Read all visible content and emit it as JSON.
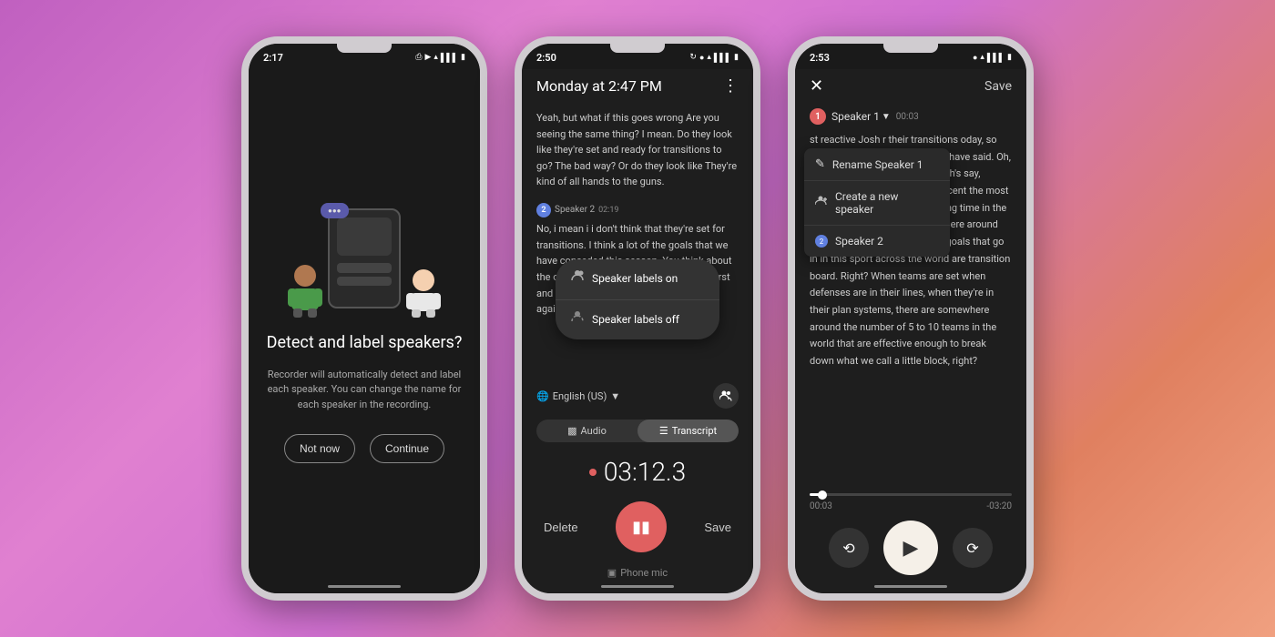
{
  "phones": {
    "phone1": {
      "status_time": "2:17",
      "status_icons": [
        "bluetooth",
        "location",
        "wifi",
        "signal",
        "battery"
      ],
      "title": "Detect and label speakers?",
      "description": "Recorder will automatically detect and label each speaker. You can change the name for each speaker in the recording.",
      "btn_not_now": "Not now",
      "btn_continue": "Continue",
      "bubble_text": "..."
    },
    "phone2": {
      "status_time": "2:50",
      "status_icons": [
        "sync",
        "location",
        "wifi",
        "signal",
        "battery"
      ],
      "recording_title": "Monday at 2:47 PM",
      "transcript_p1": "Yeah, but what if this goes wrong Are you seeing the same thing? I mean. Do they look like they're set and ready for transitions to go? The bad way? Or do they look like They're kind of all hands to the guns.",
      "speaker2_name": "Speaker 2",
      "speaker2_time": "02:19",
      "transcript_p2": "No, i mean i i don't think that they're set for transitions. I think a lot of the goals that we have conceded this season. You think about the one against new england, know, the first and the th... think unfortunately abou... against saint louis Um, It's not just the",
      "labels_on": "Speaker labels on",
      "labels_off": "Speaker labels off",
      "language": "English (US)",
      "tab_audio": "Audio",
      "tab_transcript": "Transcript",
      "timer": "03:12.3",
      "btn_delete": "Delete",
      "btn_save": "Save",
      "phone_mic_label": "Phone mic"
    },
    "phone3": {
      "status_time": "2:53",
      "status_icons": [
        "location",
        "wifi",
        "signal",
        "battery"
      ],
      "btn_save": "Save",
      "speaker1_name": "Speaker 1",
      "speaker1_time": "00:03",
      "dropdown": {
        "rename": "Rename Speaker 1",
        "new_speaker": "Create a new speaker",
        "speaker2": "Speaker 2"
      },
      "transcript_text": "st reactive Josh r their transitions oday, so we get ything that we sh would have said. Oh, you can quote, all of this as Josh's say, Transition in football is 150 percent the most dangerous, and the most exciting time in the game. I think, probably somewhere around the, the realm of 70 percent of goals that go in in this sport across the world are transition board. Right? When teams are set when defenses are in their lines, when they're in their plan systems, there are somewhere around the number of 5 to 10 teams in the world that are effective enough to break down what we call a little block, right?",
      "time_current": "00:03",
      "time_remaining": "-03:20"
    }
  }
}
